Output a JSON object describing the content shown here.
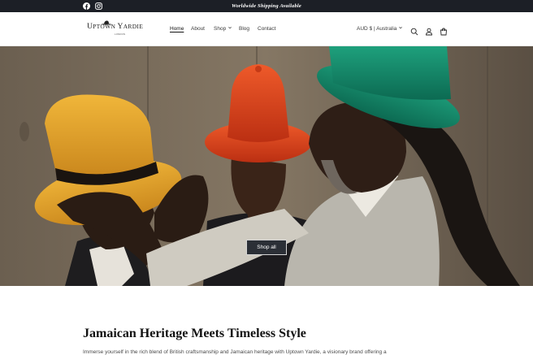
{
  "announcement": {
    "text": "Worldwide Shipping Available",
    "social": [
      {
        "name": "facebook-icon"
      },
      {
        "name": "instagram-icon"
      }
    ]
  },
  "header": {
    "logo": {
      "text": "Uptown Yardie",
      "subtext": "LONDON"
    },
    "nav": [
      {
        "label": "Home",
        "active": true
      },
      {
        "label": "About",
        "active": false
      },
      {
        "label": "Shop",
        "active": false,
        "dropdown": true
      },
      {
        "label": "Blog",
        "active": false
      },
      {
        "label": "Contact",
        "active": false
      }
    ],
    "currency": "AUD $ | Australia",
    "icons": [
      "search-icon",
      "account-icon",
      "cart-icon"
    ]
  },
  "hero": {
    "button_label": "Shop all"
  },
  "content": {
    "title": "Jamaican Heritage Meets Timeless Style",
    "text": "Immerse yourself in the rich blend of British craftsmanship and Jamaican heritage with Uptown Yardie, a visionary brand offering a"
  },
  "colors": {
    "announcement_bg": "#1c1f26",
    "hat_yellow": "#e8a32a",
    "hat_red": "#d8401e",
    "hat_green": "#138a6a",
    "button_bg": "#2b2f36"
  }
}
